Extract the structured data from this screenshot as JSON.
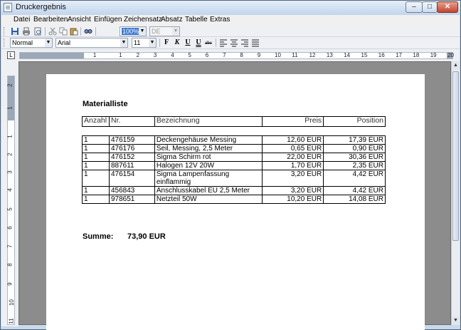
{
  "window": {
    "title": "Druckergebnis"
  },
  "menu": [
    "Datei",
    "Bearbeiten",
    "Ansicht",
    "Einfügen",
    "Zeichensatz",
    "Absatz",
    "Tabelle",
    "Extras"
  ],
  "toolbar": {
    "zoom": "100%",
    "language": "DE"
  },
  "format": {
    "style": "Normal",
    "font": "Arial",
    "size": "11"
  },
  "ruler": {
    "numbers": [
      "1",
      "1",
      "2",
      "3",
      "4",
      "5",
      "6",
      "7",
      "8",
      "9",
      "10",
      "11",
      "12",
      "13",
      "14",
      "15",
      "16",
      "17",
      "18",
      "19",
      "20"
    ]
  },
  "vruler": {
    "numbers": [
      "2",
      "1",
      "1",
      "2",
      "3",
      "4",
      "5",
      "6",
      "7",
      "8",
      "9",
      "10",
      "11"
    ]
  },
  "document": {
    "title": "Materialliste",
    "headers": [
      "Anzahl",
      "Nr.",
      "Bezeichnung",
      "Preis",
      "Position"
    ],
    "rows": [
      [
        "1",
        "476159",
        "Deckengehäuse Messing",
        "12,60 EUR",
        "17,39 EUR"
      ],
      [
        "1",
        "476176",
        "Seil, Messing, 2,5 Meter",
        "0,65 EUR",
        "0,90 EUR"
      ],
      [
        "1",
        "476152",
        "Sigma Schirm rot",
        "22,00 EUR",
        "30,36 EUR"
      ],
      [
        "1",
        "887611",
        "Halogen 12V 20W",
        "1,70 EUR",
        "2,35 EUR"
      ],
      [
        "1",
        "476154",
        "Sigma Lampenfassung einflammig",
        "3,20 EUR",
        "4,42 EUR"
      ],
      [
        "1",
        "456843",
        "Anschlusskabel EU 2,5 Meter",
        "3,20 EUR",
        "4,42 EUR"
      ],
      [
        "1",
        "978651",
        "Netzteil 50W",
        "10,20 EUR",
        "14,08 EUR"
      ]
    ],
    "sum_label": "Summe:",
    "sum_value": "73,90 EUR"
  }
}
